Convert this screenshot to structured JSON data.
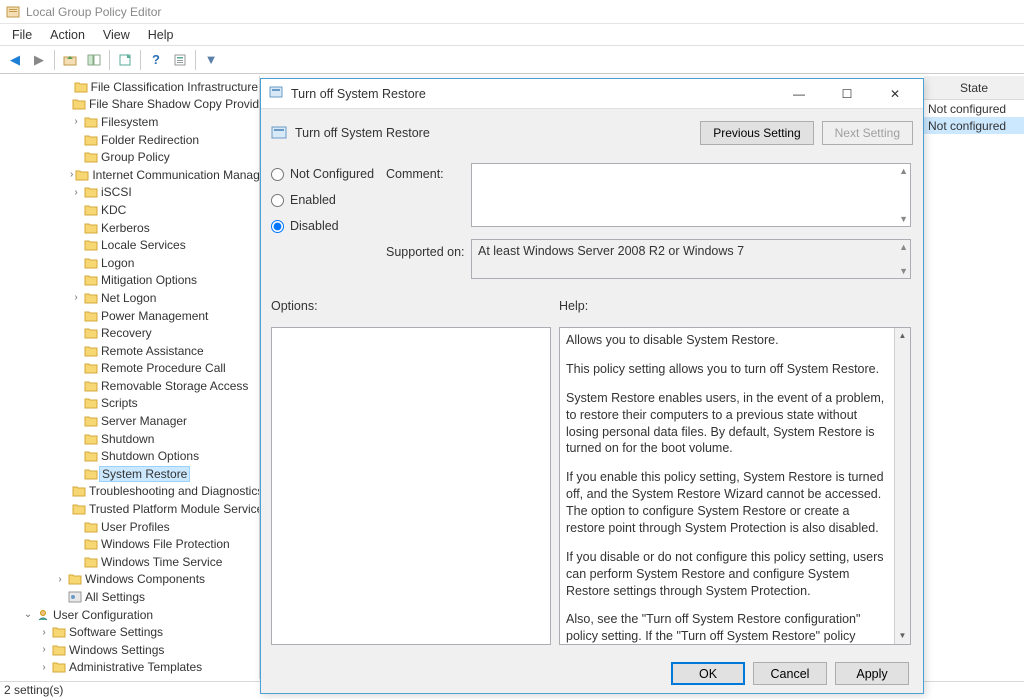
{
  "window": {
    "title": "Local Group Policy Editor"
  },
  "menu": {
    "file": "File",
    "action": "Action",
    "view": "View",
    "help": "Help"
  },
  "tree": {
    "items": [
      {
        "d": 4,
        "exp": "",
        "label": "File Classification Infrastructure"
      },
      {
        "d": 4,
        "exp": "",
        "label": "File Share Shadow Copy Provider"
      },
      {
        "d": 4,
        "exp": ">",
        "label": "Filesystem"
      },
      {
        "d": 4,
        "exp": "",
        "label": "Folder Redirection"
      },
      {
        "d": 4,
        "exp": "",
        "label": "Group Policy"
      },
      {
        "d": 4,
        "exp": ">",
        "label": "Internet Communication Management"
      },
      {
        "d": 4,
        "exp": ">",
        "label": "iSCSI"
      },
      {
        "d": 4,
        "exp": "",
        "label": "KDC"
      },
      {
        "d": 4,
        "exp": "",
        "label": "Kerberos"
      },
      {
        "d": 4,
        "exp": "",
        "label": "Locale Services"
      },
      {
        "d": 4,
        "exp": "",
        "label": "Logon"
      },
      {
        "d": 4,
        "exp": "",
        "label": "Mitigation Options"
      },
      {
        "d": 4,
        "exp": ">",
        "label": "Net Logon"
      },
      {
        "d": 4,
        "exp": "",
        "label": "Power Management"
      },
      {
        "d": 4,
        "exp": "",
        "label": "Recovery"
      },
      {
        "d": 4,
        "exp": "",
        "label": "Remote Assistance"
      },
      {
        "d": 4,
        "exp": "",
        "label": "Remote Procedure Call"
      },
      {
        "d": 4,
        "exp": "",
        "label": "Removable Storage Access"
      },
      {
        "d": 4,
        "exp": "",
        "label": "Scripts"
      },
      {
        "d": 4,
        "exp": "",
        "label": "Server Manager"
      },
      {
        "d": 4,
        "exp": "",
        "label": "Shutdown"
      },
      {
        "d": 4,
        "exp": "",
        "label": "Shutdown Options"
      },
      {
        "d": 4,
        "exp": "",
        "label": "System Restore",
        "sel": true
      },
      {
        "d": 4,
        "exp": "",
        "label": "Troubleshooting and Diagnostics"
      },
      {
        "d": 4,
        "exp": "",
        "label": "Trusted Platform Module Services"
      },
      {
        "d": 4,
        "exp": "",
        "label": "User Profiles"
      },
      {
        "d": 4,
        "exp": "",
        "label": "Windows File Protection"
      },
      {
        "d": 4,
        "exp": "",
        "label": "Windows Time Service"
      },
      {
        "d": 3,
        "exp": ">",
        "label": "Windows Components"
      },
      {
        "d": 3,
        "exp": "",
        "label": "All Settings",
        "icon": "settings"
      },
      {
        "d": 1,
        "exp": "v",
        "label": "User Configuration",
        "icon": "user"
      },
      {
        "d": 2,
        "exp": ">",
        "label": "Software Settings"
      },
      {
        "d": 2,
        "exp": ">",
        "label": "Windows Settings"
      },
      {
        "d": 2,
        "exp": ">",
        "label": "Administrative Templates"
      }
    ]
  },
  "right": {
    "header": "State",
    "rows": [
      "Not configured",
      "Not configured"
    ]
  },
  "status": {
    "text": "2 setting(s)"
  },
  "dialog": {
    "title": "Turn off System Restore",
    "heading": "Turn off System Restore",
    "prev": "Previous Setting",
    "next": "Next Setting",
    "radio_notconf": "Not Configured",
    "radio_enabled": "Enabled",
    "radio_disabled": "Disabled",
    "comment_lbl": "Comment:",
    "supported_lbl": "Supported on:",
    "supported_text": "At least Windows Server 2008 R2 or Windows 7",
    "options_lbl": "Options:",
    "help_lbl": "Help:",
    "help_paras": [
      "Allows you to disable System Restore.",
      "This policy setting allows you to turn off System Restore.",
      "System Restore enables users, in the event of a problem, to restore their computers to a previous state without losing personal data files. By default, System Restore is turned on for the boot volume.",
      "If you enable this policy setting, System Restore is turned off, and the System Restore Wizard cannot be accessed. The option to configure System Restore or create a restore point through System Protection is also disabled.",
      "If you disable or do not configure this policy setting, users can perform System Restore and configure System Restore settings through System Protection.",
      "Also, see the \"Turn off System Restore configuration\" policy setting. If the \"Turn off System Restore\" policy setting is disabled or not configured, the \"Turn off System Restore configuration\""
    ],
    "ok": "OK",
    "cancel": "Cancel",
    "apply": "Apply"
  }
}
